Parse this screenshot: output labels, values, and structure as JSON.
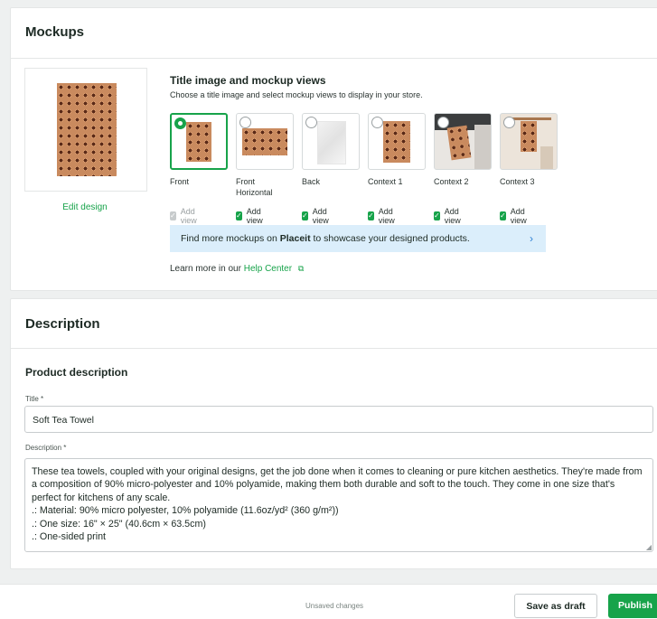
{
  "mockups": {
    "heading": "Mockups",
    "edit_design": "Edit design",
    "section_title": "Title image and mockup views",
    "section_subtitle": "Choose a title image and select mockup views to display in your store.",
    "views": [
      {
        "label": "Front",
        "add_view": "Add view",
        "checked": true,
        "disabled": true,
        "selected": true
      },
      {
        "label": "Front Horizontal",
        "add_view": "Add view",
        "checked": true,
        "disabled": false,
        "selected": false
      },
      {
        "label": "Back",
        "add_view": "Add view",
        "checked": true,
        "disabled": false,
        "selected": false
      },
      {
        "label": "Context 1",
        "add_view": "Add view",
        "checked": true,
        "disabled": false,
        "selected": false
      },
      {
        "label": "Context 2",
        "add_view": "Add view",
        "checked": true,
        "disabled": false,
        "selected": false
      },
      {
        "label": "Context 3",
        "add_view": "Add view",
        "checked": true,
        "disabled": false,
        "selected": false
      }
    ],
    "banner": {
      "prefix": "Find more mockups on ",
      "brand": "Placeit",
      "suffix": " to showcase your designed products."
    },
    "help": {
      "prefix": "Learn more in our ",
      "link": "Help Center"
    }
  },
  "description": {
    "heading": "Description",
    "subheading": "Product description",
    "title_label": "Title *",
    "title_value": "Soft Tea Towel",
    "desc_label": "Description *",
    "desc_value": "These tea towels, coupled with your original designs, get the job done when it comes to cleaning or pure kitchen aesthetics. They're made from a composition of 90% micro-polyester and 10% polyamide, making them both durable and soft to the touch. They come in one size that's perfect for kitchens of any scale.\n.: Material: 90% micro polyester, 10% polyamide (11.6oz/yd² (360 g/m²))\n.: One size: 16\" × 25\" (40.6cm × 63.5cm)\n.: One-sided print"
  },
  "footer": {
    "status": "Unsaved changes",
    "save_draft": "Save as draft",
    "publish": "Publish"
  },
  "colors": {
    "accent": "#17a34a",
    "banner_bg": "#dbeefb"
  }
}
